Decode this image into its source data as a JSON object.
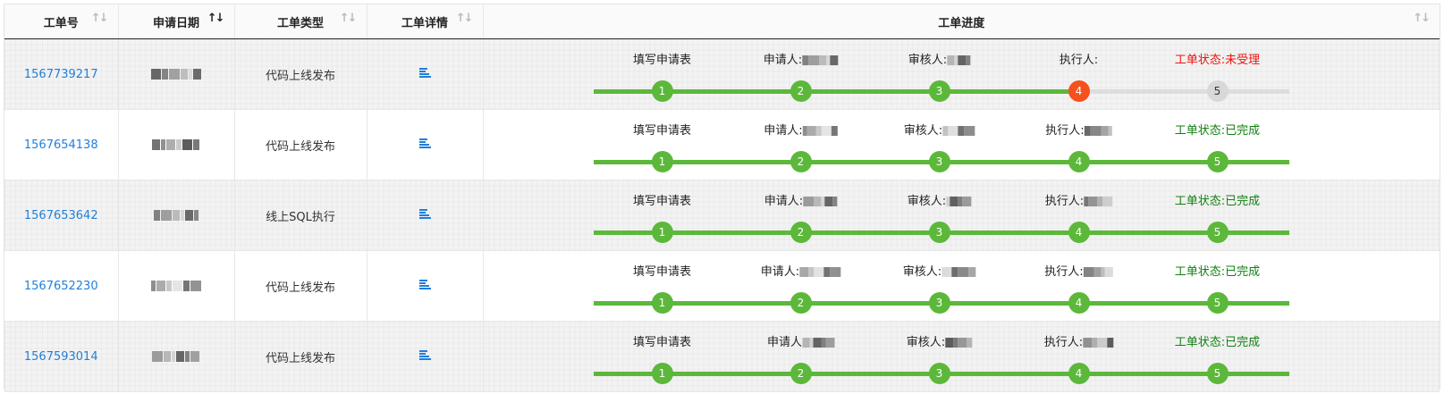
{
  "columns": [
    {
      "label": "工单号",
      "sort": "none"
    },
    {
      "label": "申请日期",
      "sort": "active"
    },
    {
      "label": "工单类型",
      "sort": "none"
    },
    {
      "label": "工单详情",
      "sort": "none"
    },
    {
      "label": "工单进度",
      "sort": "none"
    }
  ],
  "steps": [
    "填写申请表",
    "申请人:",
    "审核人:",
    "执行人:"
  ],
  "rows": [
    {
      "id": "1567739217",
      "type": "代码上线发布",
      "status": "工单状态:未受理",
      "status_color": "red",
      "current_step": 4,
      "applicant_label": "申请人:",
      "reviewer_label": "审核人:",
      "executor_label": "执行人:",
      "fill": 0.7
    },
    {
      "id": "1567654138",
      "type": "代码上线发布",
      "status": "工单状态:已完成",
      "status_color": "green",
      "current_step": 6,
      "applicant_label": "申请人:",
      "reviewer_label": "审核人:",
      "executor_label": "执行人:",
      "fill": 1.0
    },
    {
      "id": "1567653642",
      "type": "线上SQL执行",
      "status": "工单状态:已完成",
      "status_color": "green",
      "current_step": 6,
      "applicant_label": "申请人:",
      "reviewer_label": "审核人:",
      "executor_label": "执行人:",
      "fill": 1.0
    },
    {
      "id": "1567652230",
      "type": "代码上线发布",
      "status": "工单状态:已完成",
      "status_color": "green",
      "current_step": 6,
      "applicant_label": "申请人:",
      "reviewer_label": "审核人:",
      "executor_label": "执行人:",
      "fill": 1.0
    },
    {
      "id": "1567593014",
      "type": "代码上线发布",
      "status": "工单状态:已完成",
      "status_color": "green",
      "current_step": 6,
      "applicant_label": "申请人",
      "reviewer_label": "审核人:",
      "executor_label": "执行人:",
      "fill": 1.0
    }
  ],
  "dot_labels": [
    "1",
    "2",
    "3",
    "4",
    "5"
  ],
  "colors": {
    "link": "#1f7fdb",
    "green": "#5cb83a",
    "current": "#f4511e",
    "pending": "#d8d8d8",
    "status_red": "#e8140e",
    "status_green": "#118011"
  },
  "icons": {
    "sort": "sort-arrows-icon",
    "detail": "align-left-icon"
  }
}
